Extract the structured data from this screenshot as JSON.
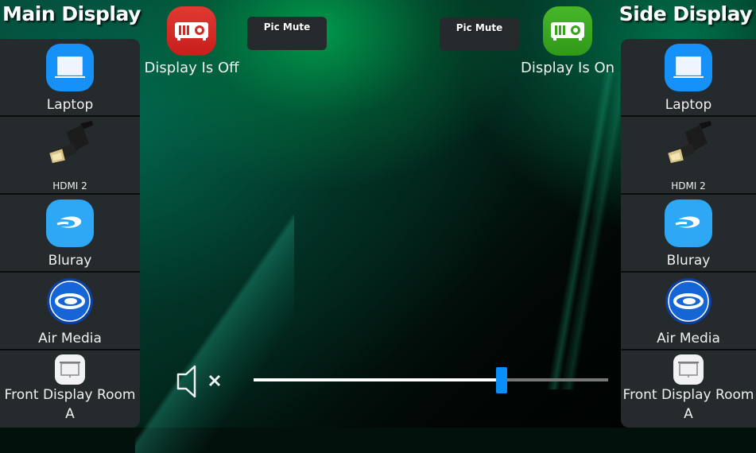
{
  "main_display": {
    "title": "Main Display",
    "sources": [
      {
        "label": "Laptop",
        "icon": "laptop-icon"
      },
      {
        "label": "HDMI 2",
        "icon": "hdmi-icon"
      },
      {
        "label": "Bluray",
        "icon": "bluray-icon"
      },
      {
        "label": "Air Media",
        "icon": "air-media-icon"
      },
      {
        "label": "Front Display Room A",
        "icon": "projection-screen-icon"
      }
    ],
    "power_status": {
      "label": "Display Is Off",
      "icon": "projector-icon",
      "color": "#d72b27"
    },
    "pic_mute_label": "Pic Mute"
  },
  "side_display": {
    "title": "Side Display",
    "sources": [
      {
        "label": "Laptop",
        "icon": "laptop-icon"
      },
      {
        "label": "HDMI 2",
        "icon": "hdmi-icon"
      },
      {
        "label": "Bluray",
        "icon": "bluray-icon"
      },
      {
        "label": "Air Media",
        "icon": "air-media-icon"
      },
      {
        "label": "Front Display Room A",
        "icon": "projection-screen-icon"
      }
    ],
    "power_status": {
      "label": "Display Is On",
      "icon": "projector-icon",
      "color": "#3aa81f"
    },
    "pic_mute_label": "Pic Mute"
  },
  "audio": {
    "muted": true,
    "mute_icon": "speaker-muted-icon",
    "volume": 0.7,
    "slider_color": "#0a8ef8"
  },
  "colors": {
    "panel_bg": "#252a2c",
    "laptop_icon_bg": "#1591f8",
    "bluray_icon_bg": "#2ea7f5"
  }
}
